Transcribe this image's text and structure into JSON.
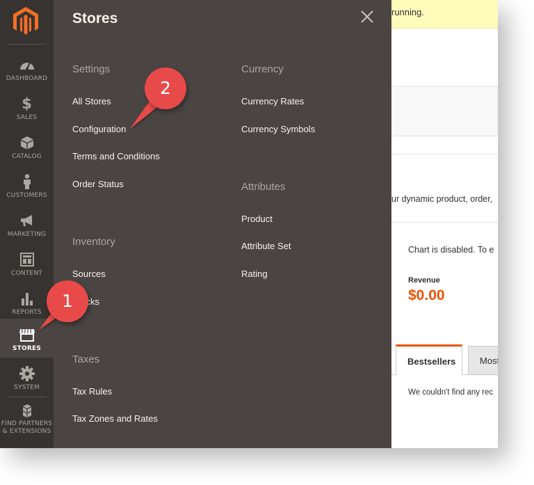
{
  "sidebar": {
    "items": [
      {
        "label": "DASHBOARD",
        "icon": "dashboard-icon"
      },
      {
        "label": "SALES",
        "icon": "dollar-icon"
      },
      {
        "label": "CATALOG",
        "icon": "box-icon"
      },
      {
        "label": "CUSTOMERS",
        "icon": "person-icon"
      },
      {
        "label": "MARKETING",
        "icon": "megaphone-icon"
      },
      {
        "label": "CONTENT",
        "icon": "layout-icon"
      },
      {
        "label": "REPORTS",
        "icon": "bar-chart-icon"
      },
      {
        "label": "STORES",
        "icon": "storefront-icon",
        "active": true
      },
      {
        "label": "SYSTEM",
        "icon": "gear-icon"
      },
      {
        "label_line1": "FIND PARTNERS",
        "label_line2": "& EXTENSIONS",
        "icon": "cubes-icon"
      }
    ]
  },
  "flyout": {
    "title": "Stores",
    "settings": {
      "heading": "Settings",
      "links": [
        "All Stores",
        "Configuration",
        "Terms and Conditions",
        "Order Status"
      ]
    },
    "inventory": {
      "heading": "Inventory",
      "links": [
        "Sources",
        "Stocks"
      ]
    },
    "taxes": {
      "heading": "Taxes",
      "links": [
        "Tax Rules",
        "Tax Zones and Rates"
      ]
    },
    "currency": {
      "heading": "Currency",
      "links": [
        "Currency Rates",
        "Currency Symbols"
      ]
    },
    "attributes": {
      "heading": "Attributes",
      "links": [
        "Product",
        "Attribute Set",
        "Rating"
      ]
    }
  },
  "main": {
    "notice_text": "running.",
    "intro_text": "ur dynamic product, order,",
    "chart_text": "Chart is disabled. To e",
    "revenue_label": "Revenue",
    "revenue_value": "$0.00",
    "tabs": [
      "Bestsellers",
      "Most"
    ],
    "empty_text": "We couldn't find any rec"
  },
  "callouts": [
    {
      "number": "1",
      "color": "#e84a4a"
    },
    {
      "number": "2",
      "color": "#e84a4a"
    }
  ],
  "colors": {
    "sidebar_bg": "#373330",
    "flyout_bg": "#4a4542",
    "accent": "#eb5202",
    "notice_bg": "#fffbbb"
  }
}
